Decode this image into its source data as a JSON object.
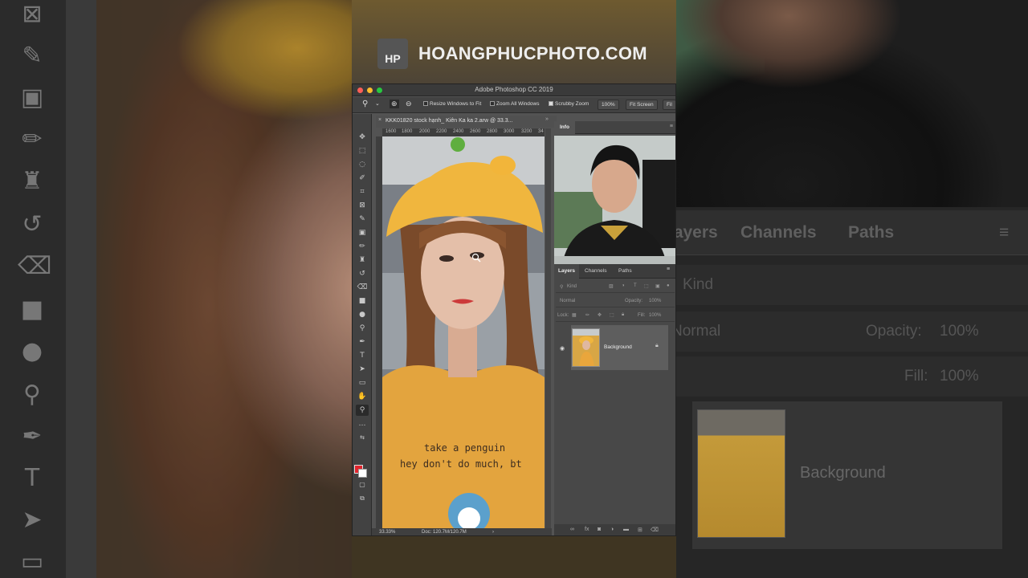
{
  "watermark": {
    "badge": "HP",
    "site": "HOANGPHUCPHOTO.COM"
  },
  "app": {
    "title": "Adobe Photoshop CC 2019"
  },
  "options_bar": {
    "resize_windows": "Resize Windows to Fit",
    "zoom_all_windows": "Zoom All Windows",
    "scrubby_zoom": "Scrubby Zoom",
    "zoom_value": "100%",
    "fit_screen": "Fit Screen",
    "fill_screen": "Fil"
  },
  "document": {
    "tab_title": "KKK01820 stock hạnh_ Kiên Ka ka 2.arw @ 33.3...",
    "ruler_ticks": [
      "1600",
      "1800",
      "2000",
      "2200",
      "2400",
      "2600",
      "2800",
      "3000",
      "3200",
      "34"
    ],
    "shirt_text_line1": "take a penguin",
    "shirt_text_line2": "hey don't do much, bt"
  },
  "status_bar": {
    "zoom": "33.33%",
    "doc_size": "Doc: 120.7M/120.7M"
  },
  "panels": {
    "info_tab": "Info",
    "layers_tab": "Layers",
    "channels_tab": "Channels",
    "paths_tab": "Paths",
    "kind_placeholder": "Kind",
    "blend_mode": "Normal",
    "opacity_label": "Opacity:",
    "opacity_value": "100%",
    "lock_label": "Lock:",
    "fill_label": "Fill:",
    "fill_value": "100%",
    "layer_name": "Background"
  },
  "icons": {
    "tools": [
      "move-icon",
      "marquee-icon",
      "lasso-icon",
      "quick-select-icon",
      "crop-icon",
      "frame-icon",
      "eyedropper-icon",
      "healing-brush-icon",
      "brush-icon",
      "clone-stamp-icon",
      "history-brush-icon",
      "eraser-icon",
      "gradient-icon",
      "blur-icon",
      "dodge-icon",
      "pen-icon",
      "type-icon",
      "path-select-icon",
      "rectangle-icon",
      "hand-icon",
      "zoom-icon",
      "more-tools-icon"
    ]
  },
  "colors": {
    "foreground": "#e0242c",
    "background": "#ffffff",
    "accent": "#535353"
  }
}
